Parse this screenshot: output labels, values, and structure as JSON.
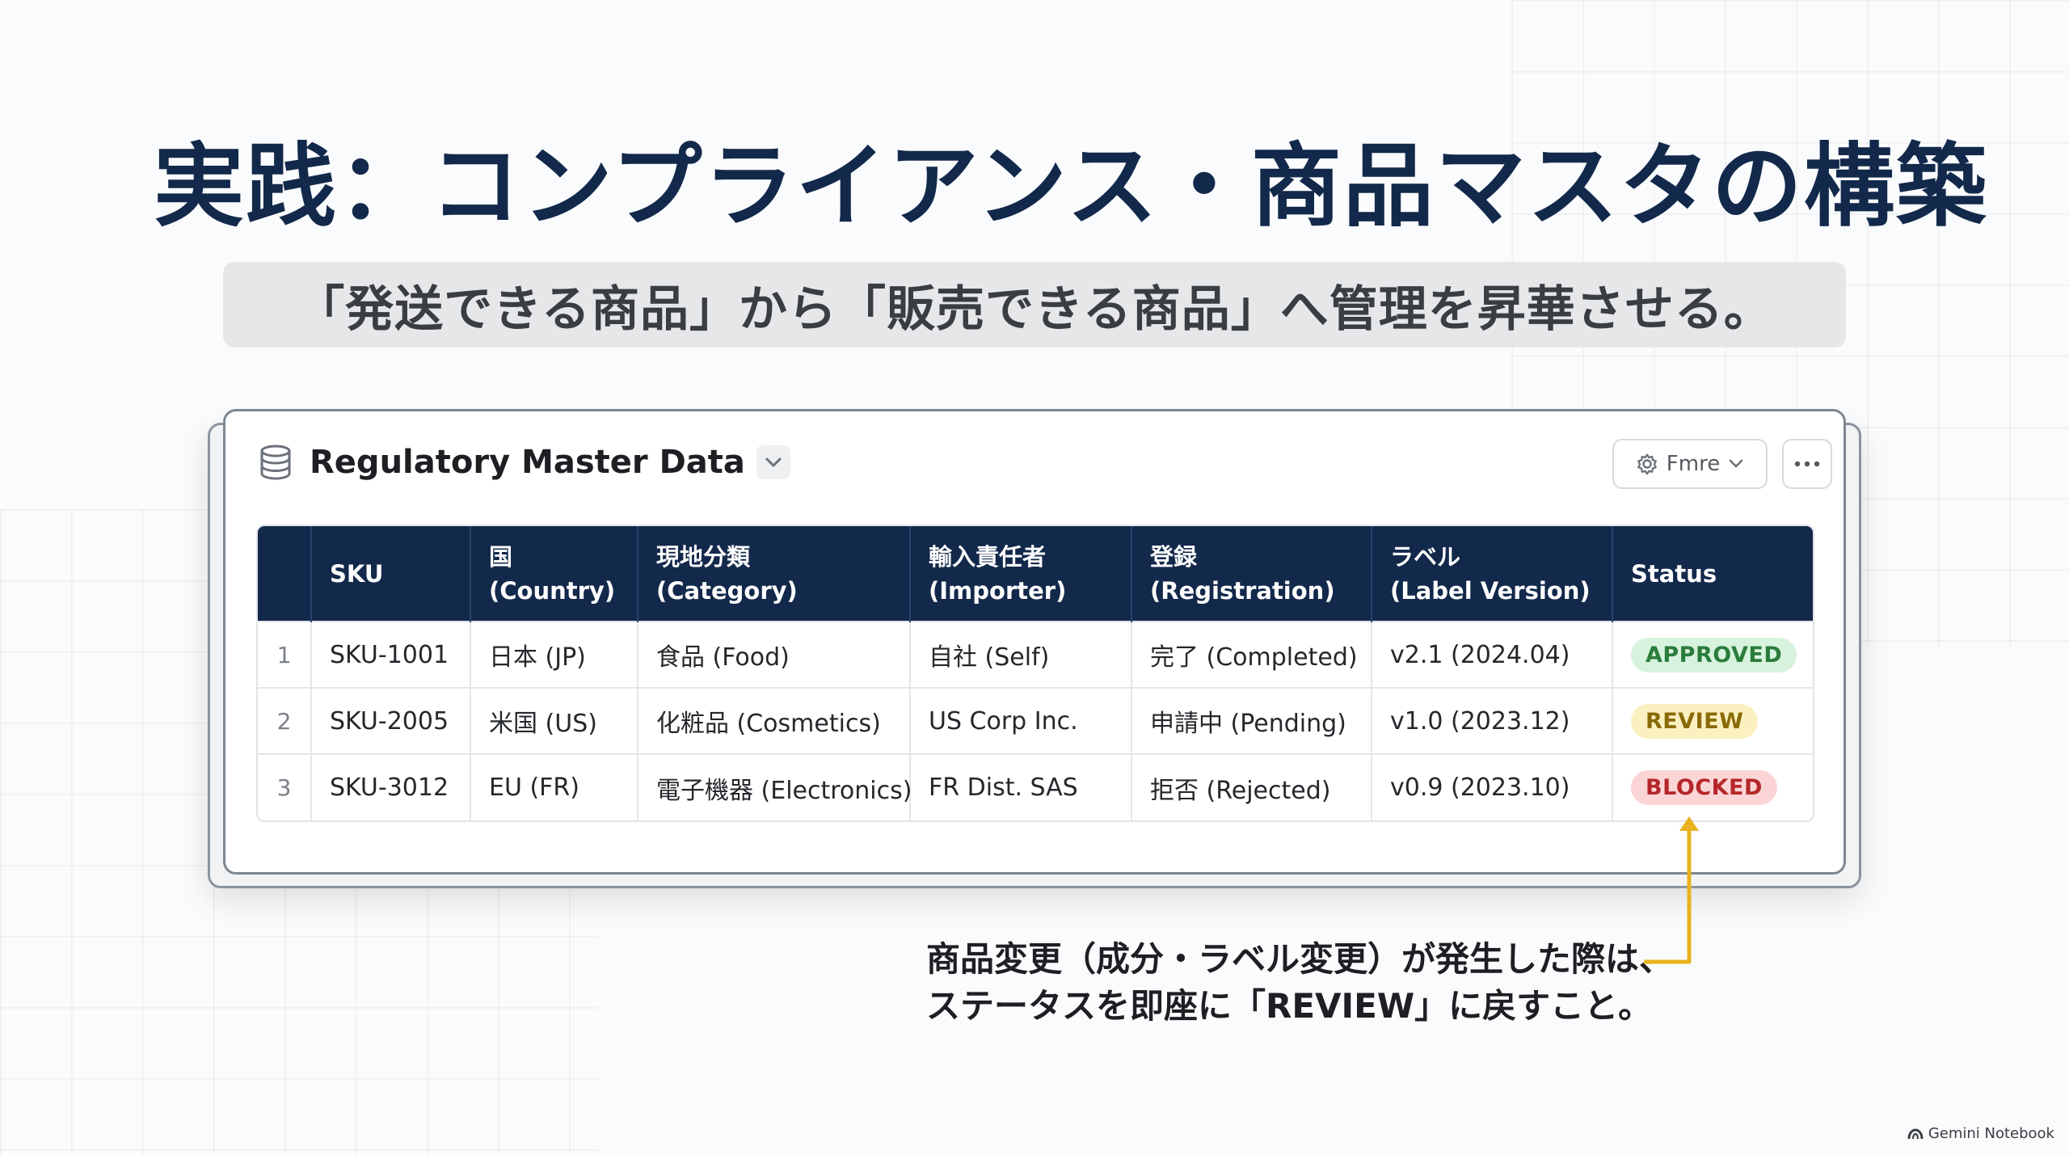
{
  "slide": {
    "title": "実践：コンプライアンス・商品マスタの構築",
    "subtitle": "「発送できる商品」から「販売できる商品」へ管理を昇華させる。"
  },
  "card": {
    "title": "Regulatory Master Data",
    "db_icon": "database-icon",
    "view_button_label": "Fmre",
    "more_icon": "ellipsis-icon"
  },
  "table": {
    "headers": [
      {
        "line1": "",
        "line2": ""
      },
      {
        "line1": "SKU",
        "line2": ""
      },
      {
        "line1": "国",
        "line2": "(Country)"
      },
      {
        "line1": "現地分類",
        "line2": "(Category)"
      },
      {
        "line1": "輸入責任者",
        "line2": "(Importer)"
      },
      {
        "line1": "登録",
        "line2": "(Registration)"
      },
      {
        "line1": "ラベル",
        "line2": "(Label Version)"
      },
      {
        "line1": "Status",
        "line2": ""
      }
    ],
    "rows": [
      {
        "num": "1",
        "sku": "SKU-1001",
        "country": "日本 (JP)",
        "category": "食品 (Food)",
        "importer": "自社 (Self)",
        "registration": "完了 (Completed)",
        "label": "v2.1 (2024.04)",
        "status": "APPROVED"
      },
      {
        "num": "2",
        "sku": "SKU-2005",
        "country": "米国 (US)",
        "category": "化粧品 (Cosmetics)",
        "importer": "US Corp Inc.",
        "registration": "申請中 (Pending)",
        "label": "v1.0 (2023.12)",
        "status": "REVIEW"
      },
      {
        "num": "3",
        "sku": "SKU-3012",
        "country": "EU (FR)",
        "category": "電子機器 (Electronics)",
        "importer": "FR Dist. SAS",
        "registration": "拒否 (Rejected)",
        "label": "v0.9 (2023.10)",
        "status": "BLOCKED"
      }
    ]
  },
  "annotation": {
    "line1": "商品変更（成分・ラベル変更）が発生した際は、",
    "line2": "ステータスを即座に「REVIEW」に戻すこと。",
    "color": "#e8b21e"
  },
  "footer": {
    "brand": "Gemini Notebook"
  },
  "colors": {
    "title": "#13294b",
    "table_header": "#13294b",
    "approved": "#2a7c3b",
    "review": "#8a6a07",
    "blocked": "#b4262a"
  }
}
